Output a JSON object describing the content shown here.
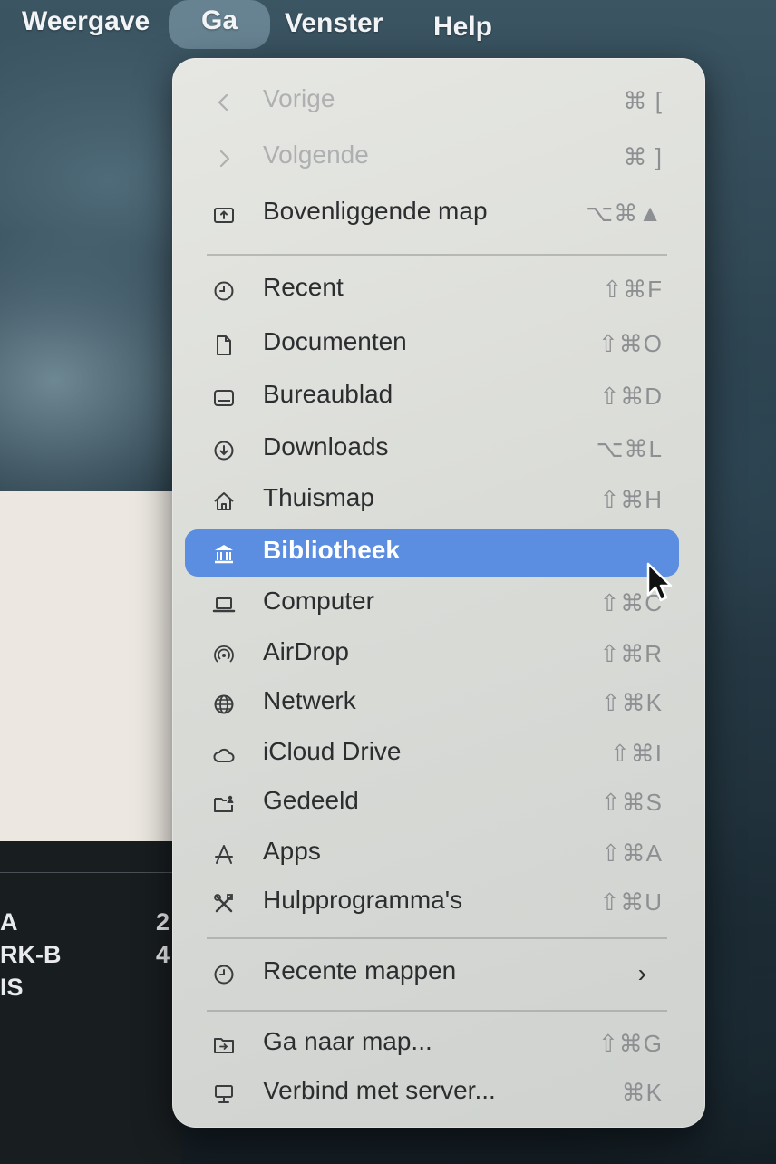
{
  "menubar": {
    "items": [
      "Weergave",
      "Ga",
      "Venster",
      "Help"
    ],
    "active_index": 1
  },
  "background_window": {
    "rows": [
      {
        "label": "A",
        "value": "2"
      },
      {
        "label": "RK-B",
        "value": "4"
      },
      {
        "label": "IS",
        "value": ""
      }
    ]
  },
  "menu": {
    "items": [
      {
        "label": "Vorige",
        "shortcut": "⌘ [",
        "icon": "chevron-left-icon",
        "disabled": true
      },
      {
        "label": "Volgende",
        "shortcut": "⌘ ]",
        "icon": "chevron-right-icon",
        "disabled": true
      },
      {
        "label": "Bovenliggende map",
        "shortcut": "⌥⌘▲",
        "icon": "enclosing-folder-icon"
      },
      {
        "label": "Recent",
        "shortcut": "⇧⌘F",
        "icon": "clock-icon"
      },
      {
        "label": "Documenten",
        "shortcut": "⇧⌘O",
        "icon": "document-icon"
      },
      {
        "label": "Bureaublad",
        "shortcut": "⇧⌘D",
        "icon": "desktop-icon"
      },
      {
        "label": "Downloads",
        "shortcut": "⌥⌘L",
        "icon": "download-icon"
      },
      {
        "label": "Thuismap",
        "shortcut": "⇧⌘H",
        "icon": "home-icon"
      },
      {
        "label": "Bibliotheek",
        "shortcut": "",
        "icon": "library-icon",
        "selected": true
      },
      {
        "label": "Computer",
        "shortcut": "⇧⌘C",
        "icon": "laptop-icon"
      },
      {
        "label": "AirDrop",
        "shortcut": "⇧⌘R",
        "icon": "airdrop-icon"
      },
      {
        "label": "Netwerk",
        "shortcut": "⇧⌘K",
        "icon": "globe-icon"
      },
      {
        "label": "iCloud Drive",
        "shortcut": "⇧⌘I",
        "icon": "cloud-icon"
      },
      {
        "label": "Gedeeld",
        "shortcut": "⇧⌘S",
        "icon": "shared-folder-icon"
      },
      {
        "label": "Apps",
        "shortcut": "⇧⌘A",
        "icon": "apps-icon"
      },
      {
        "label": "Hulpprogramma's",
        "shortcut": "⇧⌘U",
        "icon": "utilities-icon"
      },
      {
        "label": "Recente mappen",
        "shortcut": "",
        "icon": "clock-icon",
        "submenu": true,
        "submenu_glyph": "›"
      },
      {
        "label": "Ga naar map...",
        "shortcut": "⇧⌘G",
        "icon": "go-to-folder-icon"
      },
      {
        "label": "Verbind met server...",
        "shortcut": "⌘K",
        "icon": "server-icon"
      }
    ]
  },
  "colors": {
    "selection": "#5b8ee0",
    "menu_bg": "#dcdedb"
  }
}
